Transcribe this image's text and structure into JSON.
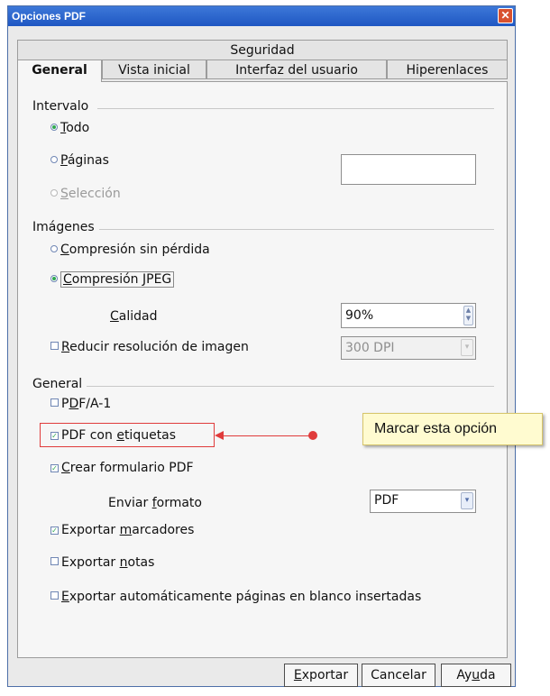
{
  "window": {
    "title": "Opciones PDF",
    "close_label": "✕"
  },
  "tabs": {
    "top": "Seguridad",
    "row": [
      {
        "label": "General"
      },
      {
        "label": "Vista inicial"
      },
      {
        "label": "Interfaz del usuario"
      },
      {
        "label": "Hiperenlaces"
      }
    ]
  },
  "intervalo": {
    "title": "Intervalo",
    "todo": {
      "u": "T",
      "rest": "odo"
    },
    "paginas": {
      "u": "P",
      "rest": "áginas",
      "value": ""
    },
    "seleccion": {
      "u": "S",
      "rest": "elección"
    }
  },
  "imagenes": {
    "title": "Imágenes",
    "sin_perdida": {
      "u": "C",
      "rest": "ompresión sin pérdida"
    },
    "jpeg": {
      "u": "C",
      "rest": "ompresión JPEG"
    },
    "calidad": {
      "u": "C",
      "rest": "alidad",
      "value": "90%"
    },
    "reducir": {
      "u": "R",
      "rest": "educir resolución de imagen",
      "value": "300 DPI"
    }
  },
  "general": {
    "title": "General",
    "pdfa": {
      "pre": "P",
      "u": "D",
      "rest": "F/A-1"
    },
    "etiquetas": {
      "pre": "PDF con ",
      "u": "e",
      "rest": "tiquetas"
    },
    "formulario": {
      "u": "C",
      "rest": "rear formulario PDF"
    },
    "enviar": {
      "pre": "Enviar ",
      "u": "f",
      "rest": "ormato",
      "value": "PDF"
    },
    "marcadores": {
      "pre": "Exportar ",
      "u": "m",
      "rest": "arcadores"
    },
    "notas": {
      "pre": "Exportar ",
      "u": "n",
      "rest": "otas"
    },
    "blanco": {
      "u": "E",
      "rest": "xportar automáticamente páginas en blanco insertadas"
    }
  },
  "buttons": {
    "exportar": {
      "u": "E",
      "rest": "xportar"
    },
    "cancelar": {
      "label": "Cancelar"
    },
    "ayuda": {
      "pre": "Ay",
      "u": "u",
      "rest": "da"
    }
  },
  "callout": {
    "text": "Marcar esta opción"
  },
  "colors": {
    "accent": "#1f57c3",
    "annotation": "#e03b3b",
    "check": "#2fa84f"
  }
}
